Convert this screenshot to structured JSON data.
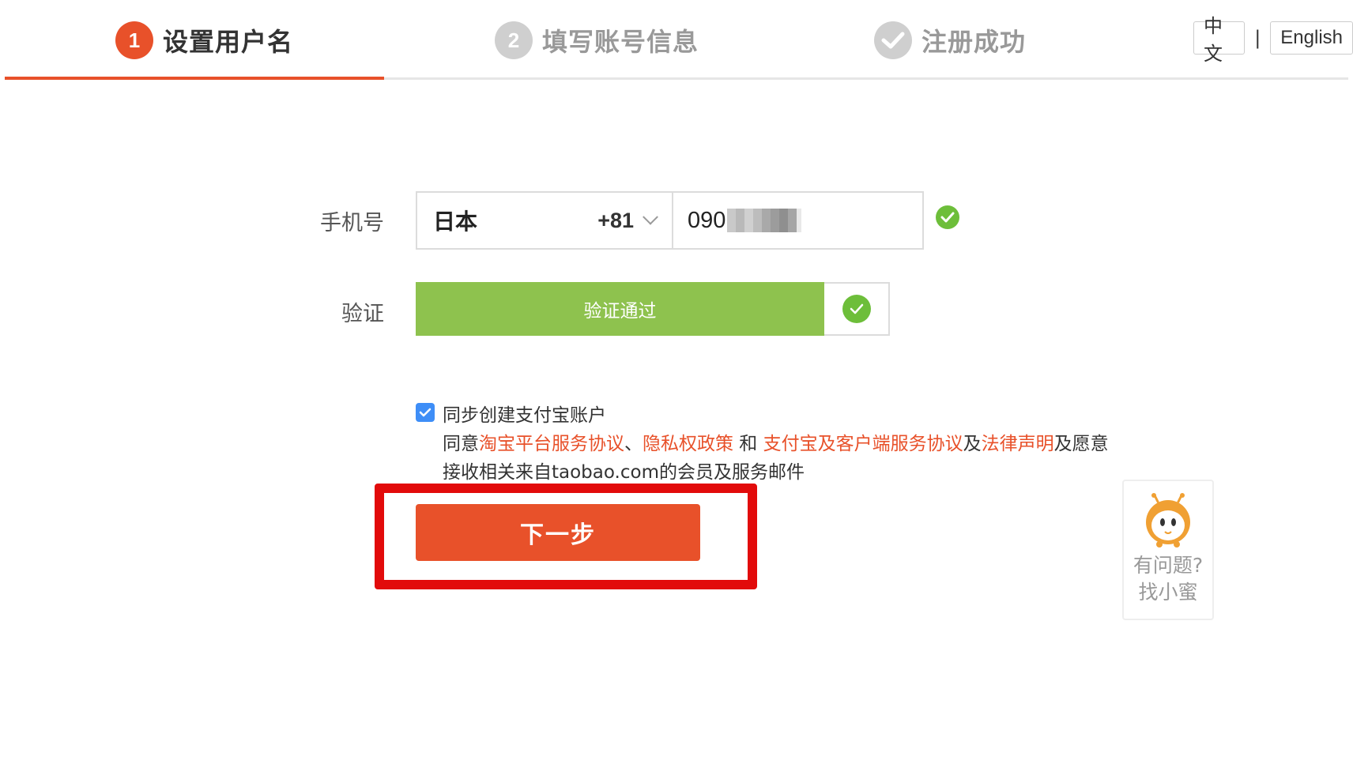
{
  "steps": [
    {
      "num": "1",
      "label": "设置用户名",
      "state": "active"
    },
    {
      "num": "2",
      "label": "填写账号信息",
      "state": "pending"
    },
    {
      "num": "",
      "label": "注册成功",
      "state": "pending",
      "icon": "check-icon"
    }
  ],
  "lang": {
    "zh": "中文",
    "sep": "|",
    "en": "English"
  },
  "form": {
    "phone_label": "手机号",
    "country_name": "日本",
    "country_code": "+81",
    "phone_number": "090",
    "verify_label": "验证",
    "verify_status": "验证通过"
  },
  "agreement": {
    "checkbox_label": "同步创建支付宝账户",
    "text_prefix": "同意",
    "link_taobao": "淘宝平台服务协议",
    "sep1": "、",
    "link_privacy": "隐私权政策",
    "and": " 和 ",
    "link_alipay": "支付宝及客户端服务协议",
    "and2": "及",
    "link_legal": "法律声明",
    "suffix": "及愿意",
    "line3": "接收相关来自taobao.com的会员及服务邮件"
  },
  "next_button": "下一步",
  "help": {
    "line1": "有问题?",
    "line2": "找小蜜"
  },
  "colors": {
    "accent": "#e8512a",
    "success": "#6dbe3a",
    "verify_bar": "#8ec24e",
    "highlight": "#e20b0b"
  }
}
